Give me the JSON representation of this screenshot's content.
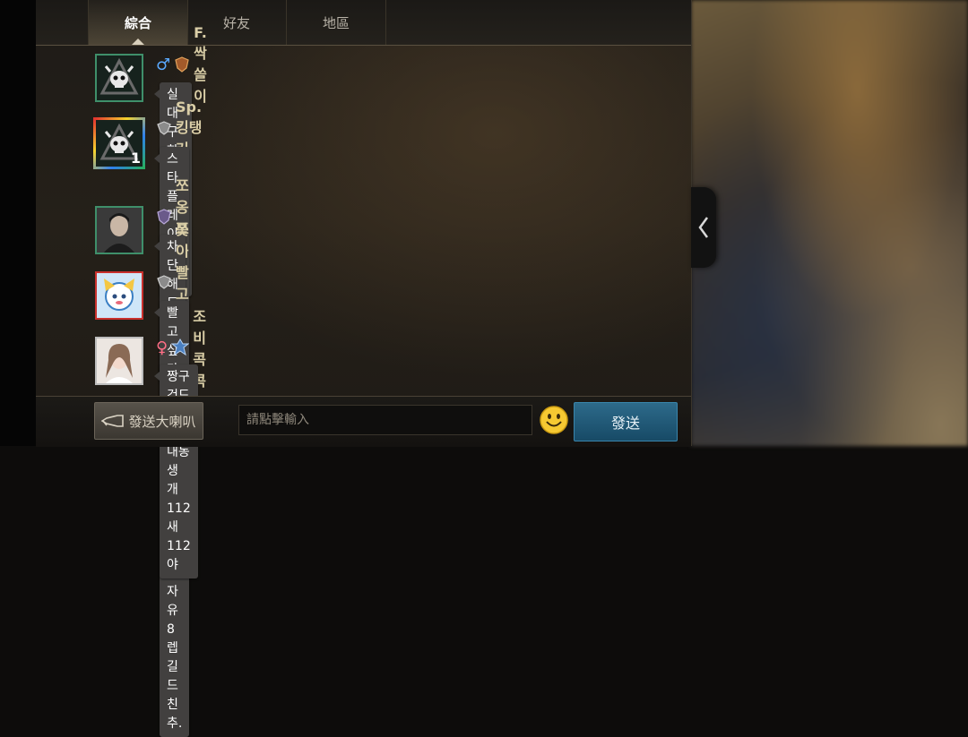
{
  "tabs": [
    {
      "label": "綜合",
      "active": true
    },
    {
      "label": "好友",
      "active": false
    },
    {
      "label": "地區",
      "active": false
    }
  ],
  "messages": [
    {
      "gender": "♂",
      "name": "F.싹쓸이",
      "text_lines": [
        "실대 구한다고 아무도 없냐?"
      ]
    },
    {
      "gender": "",
      "name": "Sp.킹탱커",
      "text_lines": [
        "스타플레이어길드에서 길원모셔요",
        "성인.단톡필수.닉변자유 8렙길드 친추."
      ]
    },
    {
      "gender": "",
      "name": "쪼옹쪼옹",
      "text_lines": [
        "차단해도 채팅은 뜨네"
      ]
    },
    {
      "gender": "",
      "name": "봊이빨고싶다",
      "text_lines": [
        "빨고싶다."
      ]
    },
    {
      "gender": "♀",
      "name": "조비콕콕",
      "text_lines": [
        "짱구건드라지마 내동생 개112새112야"
      ]
    }
  ],
  "avatar_badge": "1",
  "bottom": {
    "horn_label": "發送大喇叭",
    "input_placeholder": "請點擊輸入",
    "send_label": "發送"
  },
  "colors": {
    "accent_send": "#1f5878",
    "name_color": "#d9cda6",
    "bubble": "#42403f"
  }
}
